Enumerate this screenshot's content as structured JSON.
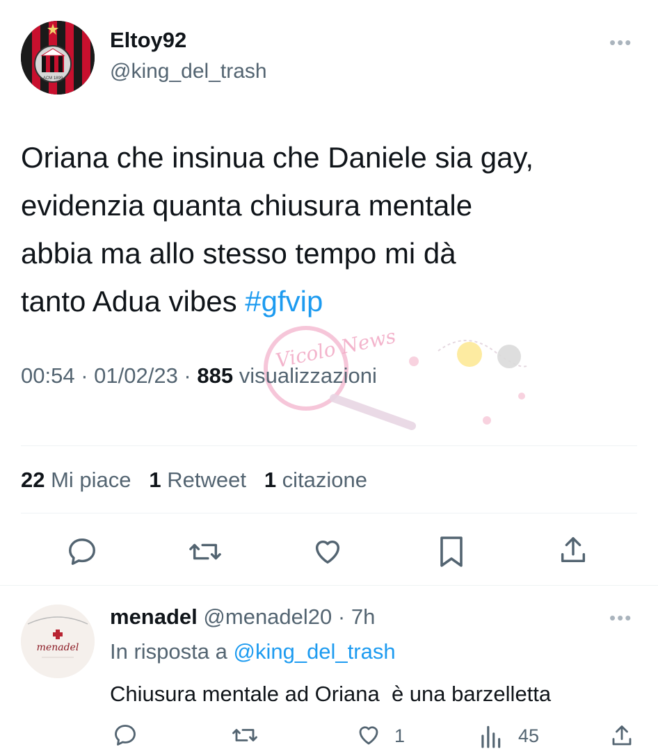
{
  "tweet": {
    "author_name": "Eltoy92",
    "author_handle": "@king_del_trash",
    "text_lines": [
      "Oriana che insinua che Daniele sia gay,",
      "evidenzia quanta chiusura mentale",
      "abbia ma allo stesso tempo mi dà",
      "tanto Adua vibes "
    ],
    "hashtag": "#gfvip",
    "time": "00:54",
    "sep1": " · ",
    "date": "01/02/23",
    "sep2": " · ",
    "views_count": "885",
    "views_label": " visualizzazioni",
    "watermark_text": "Vicolo News",
    "stats": {
      "likes_count": "22",
      "likes_label": " Mi piace",
      "retweets_count": "1",
      "retweets_label": " Retweet",
      "quotes_count": "1",
      "quotes_label": " citazione"
    },
    "avatar_badge": "ACM 1899",
    "colors": {
      "accent": "#1d9bf0",
      "text": "#0f1419",
      "muted": "#536471"
    }
  },
  "actions": [
    "reply-icon",
    "retweet-icon",
    "like-icon",
    "bookmark-icon",
    "share-icon"
  ],
  "reply": {
    "author_name": "menadel",
    "author_handle": "@menadel20",
    "sep": " · ",
    "time": "7h",
    "in_reply_prefix": "In risposta a ",
    "in_reply_handle": "@king_del_trash",
    "text": "Chiusura mentale ad Oriana  è una barzelletta",
    "like_count": "1",
    "views_count": "45",
    "avatar_text": "menadel"
  }
}
